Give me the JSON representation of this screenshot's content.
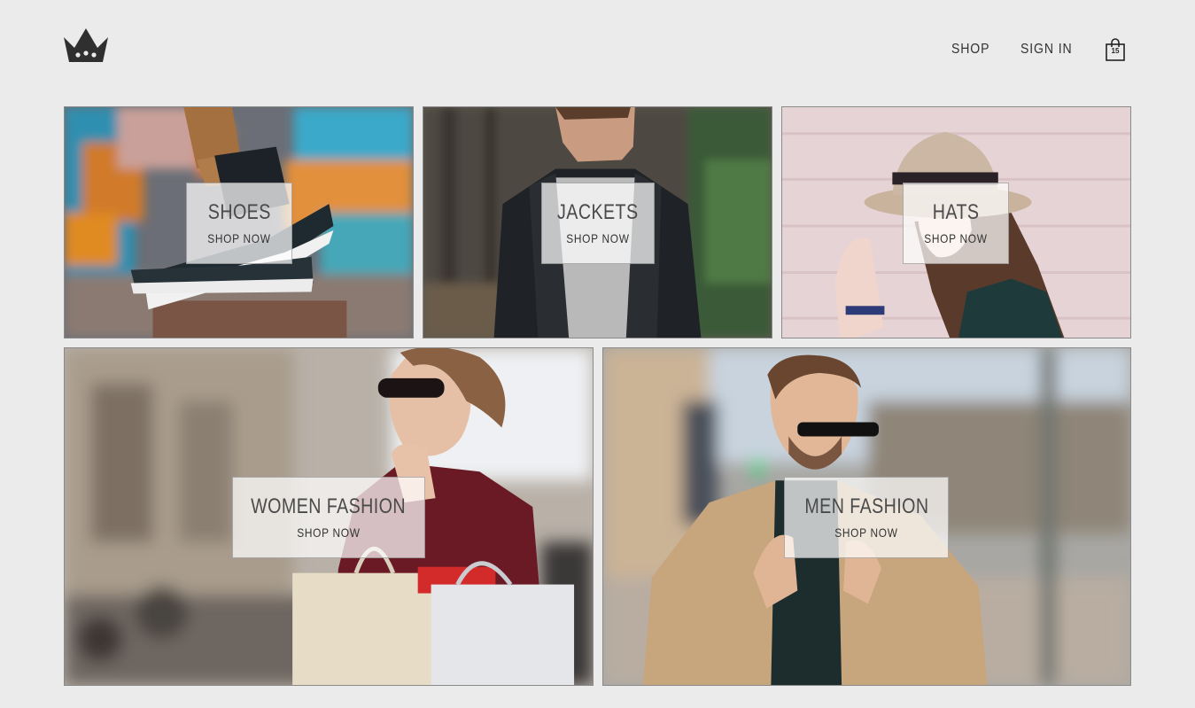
{
  "header": {
    "logo_icon": "crown-icon",
    "nav": {
      "shop_label": "SHOP",
      "signin_label": "SIGN IN",
      "cart_icon": "shopping-bag-icon",
      "cart_count": "15"
    }
  },
  "categories": [
    {
      "title": "SHOES",
      "cta": "SHOP NOW",
      "image": "sneakers-on-ledge-photo"
    },
    {
      "title": "JACKETS",
      "cta": "SHOP NOW",
      "image": "man-in-leather-jacket-photo"
    },
    {
      "title": "HATS",
      "cta": "SHOP NOW",
      "image": "woman-in-hat-photo"
    },
    {
      "title": "WOMEN FASHION",
      "cta": "SHOP NOW",
      "image": "woman-with-shopping-bags-photo"
    },
    {
      "title": "MEN FASHION",
      "cta": "SHOP NOW",
      "image": "man-in-camel-coat-photo"
    }
  ],
  "colors": {
    "page_background": "#ebebeb",
    "text": "#333333",
    "label_box": "rgba(255,255,255,0.72)"
  }
}
